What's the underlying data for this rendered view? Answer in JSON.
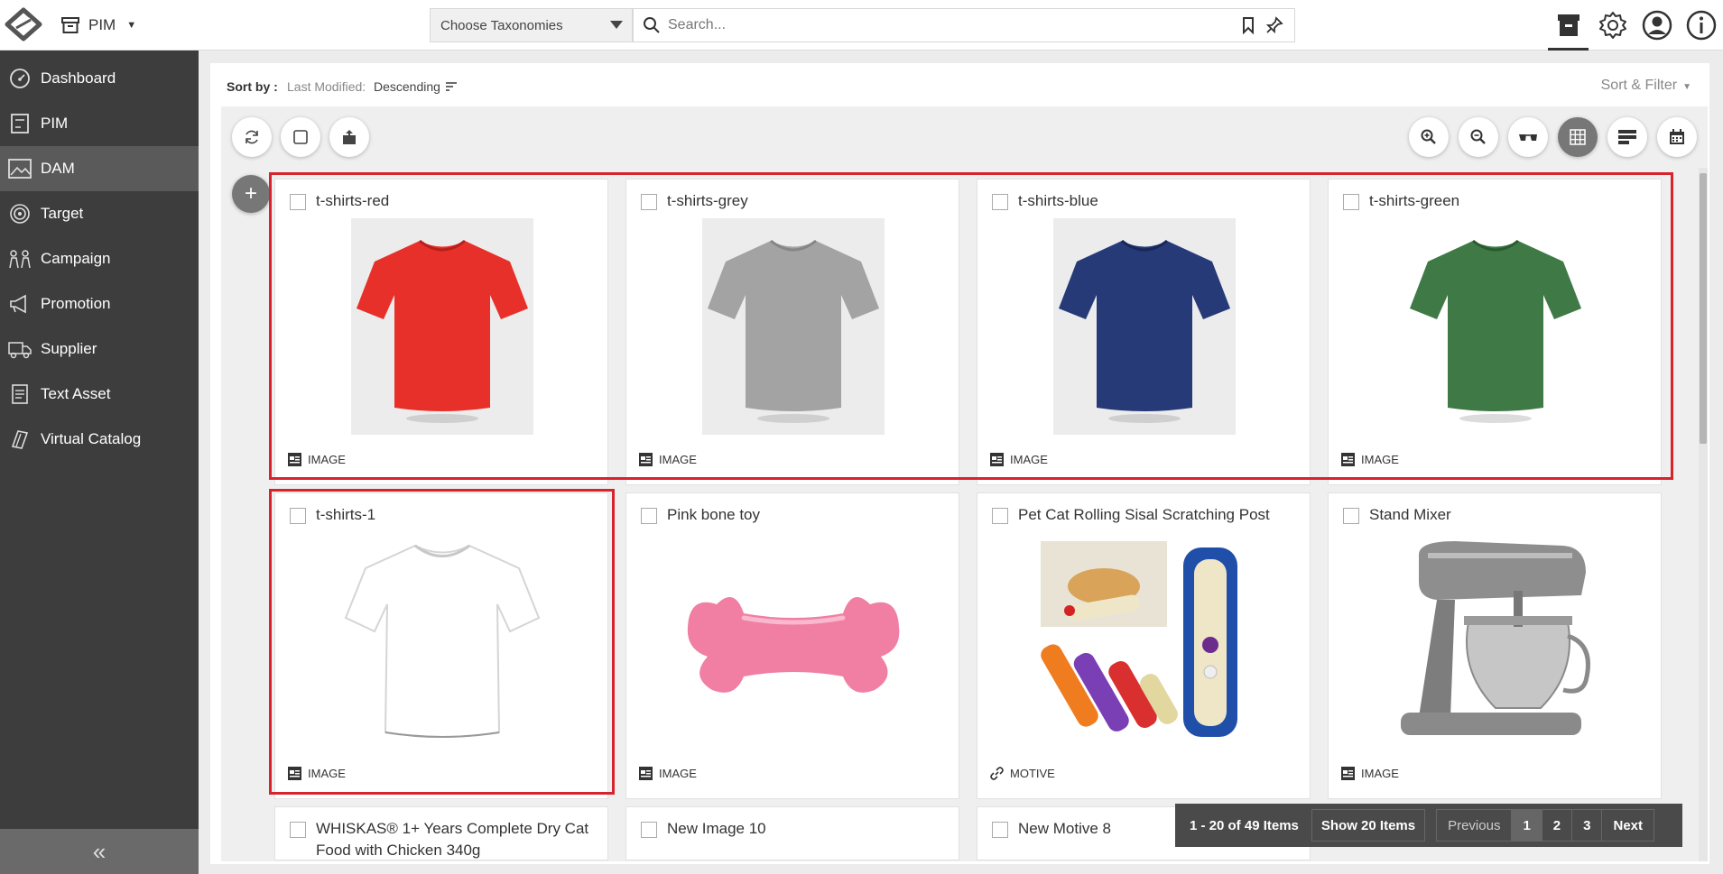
{
  "header": {
    "module_label": "PIM",
    "taxonomy_placeholder": "Choose Taxonomies",
    "search_placeholder": "Search..."
  },
  "sidebar": {
    "items": [
      {
        "label": "Dashboard",
        "icon": "dashboard-icon"
      },
      {
        "label": "PIM",
        "icon": "pim-icon"
      },
      {
        "label": "DAM",
        "icon": "image-icon",
        "active": true
      },
      {
        "label": "Target",
        "icon": "target-icon"
      },
      {
        "label": "Campaign",
        "icon": "campaign-icon"
      },
      {
        "label": "Promotion",
        "icon": "megaphone-icon"
      },
      {
        "label": "Supplier",
        "icon": "truck-icon"
      },
      {
        "label": "Text Asset",
        "icon": "document-icon"
      },
      {
        "label": "Virtual Catalog",
        "icon": "catalog-icon"
      }
    ],
    "collapse_glyph": "«"
  },
  "sort": {
    "label": "Sort by :",
    "field": "Last Modified:",
    "direction": "Descending",
    "sort_filter_label": "Sort & Filter"
  },
  "assets": [
    {
      "title": "t-shirts-red",
      "type": "IMAGE",
      "shirt_color": "#e8302a"
    },
    {
      "title": "t-shirts-grey",
      "type": "IMAGE",
      "shirt_color": "#a3a3a3"
    },
    {
      "title": "t-shirts-blue",
      "type": "IMAGE",
      "shirt_color": "#263a78"
    },
    {
      "title": "t-shirts-green",
      "type": "IMAGE",
      "shirt_color": "#3f7a46"
    },
    {
      "title": "t-shirts-1",
      "type": "IMAGE",
      "shirt_color": "#ffffff"
    },
    {
      "title": "Pink bone toy",
      "type": "IMAGE"
    },
    {
      "title": "Pet Cat Rolling Sisal Scratching Post",
      "type": "MOTIVE"
    },
    {
      "title": "Stand Mixer",
      "type": "IMAGE"
    },
    {
      "title": "WHISKAS® 1+ Years Complete Dry Cat Food with Chicken 340g"
    },
    {
      "title": "New Image 10"
    },
    {
      "title": "New Motive 8"
    }
  ],
  "pager": {
    "count": "1 - 20 of 49 Items",
    "show": "Show 20 Items",
    "previous": "Previous",
    "pages": [
      "1",
      "2",
      "3"
    ],
    "next": "Next"
  },
  "colors": {
    "sidebar_bg": "#3d3d3d",
    "highlight": "#d6232c",
    "pager_bg": "#4a4a4a"
  }
}
